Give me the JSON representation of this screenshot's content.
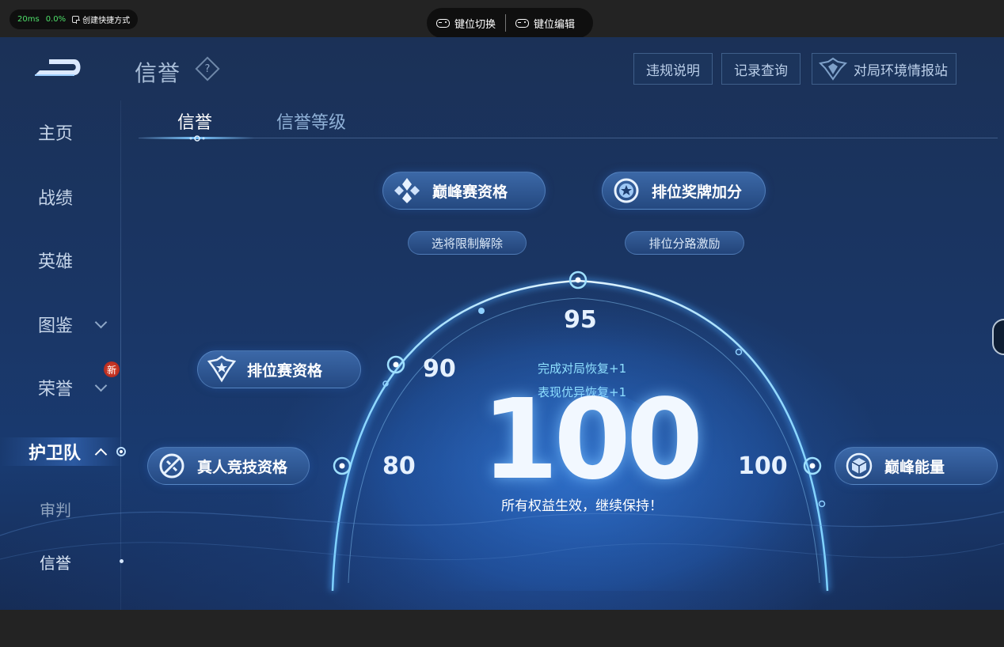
{
  "emulator": {
    "latency": "20ms",
    "loss": "0.0%",
    "shortcut_label": "创建快捷方式",
    "key_switch_label": "键位切换",
    "key_edit_label": "键位编辑"
  },
  "header": {
    "title": "信誉",
    "help_glyph": "?",
    "buttons": {
      "rules": "违规说明",
      "records": "记录查询",
      "intel": "对局环境情报站"
    }
  },
  "sidebar": {
    "items": [
      {
        "label": "主页"
      },
      {
        "label": "战绩"
      },
      {
        "label": "英雄"
      },
      {
        "label": "图鉴"
      },
      {
        "label": "荣誉"
      },
      {
        "label": "护卫队"
      },
      {
        "label": "审判"
      },
      {
        "label": "信誉"
      }
    ],
    "new_badge": "新"
  },
  "tabs": [
    {
      "label": "信誉"
    },
    {
      "label": "信誉等级"
    }
  ],
  "benefits": {
    "peak_match": "巅峰赛资格",
    "peak_sub": "选将限制解除",
    "rank_medal": "排位奖牌加分",
    "rank_sub": "排位分路激励",
    "rank_match": "排位赛资格",
    "real_player": "真人竞技资格",
    "peak_energy": "巅峰能量"
  },
  "score": {
    "tick_80": "80",
    "tick_90": "90",
    "tick_95": "95",
    "tick_100": "100",
    "value": "100",
    "recover_1": "完成对局恢复+1",
    "recover_2": "表现优异恢复+1",
    "status": "所有权益生效，继续保持！"
  },
  "colors": {
    "accent": "#7cc7ff",
    "background": "#1a3563",
    "pill": "#2f5a96",
    "badge": "#c8321f"
  },
  "icons": [
    "shortcut-icon",
    "gamepad-icon",
    "help-icon",
    "intel-emblem-icon",
    "peak-icon",
    "medal-icon",
    "rank-shield-icon",
    "real-player-icon",
    "energy-cube-icon",
    "chevron-down-icon",
    "chevron-up-icon"
  ]
}
